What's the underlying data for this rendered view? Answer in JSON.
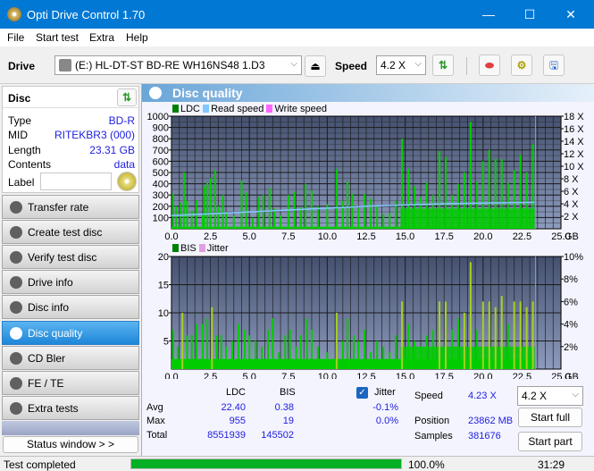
{
  "window": {
    "title": "Opti Drive Control 1.70",
    "minimize": "—",
    "maximize": "☐",
    "close": "✕"
  },
  "menu": [
    "File",
    "Start test",
    "Extra",
    "Help"
  ],
  "toolbar": {
    "drive_label": "Drive",
    "drive_value": "(E:)  HL-DT-ST BD-RE  WH16NS48 1.D3",
    "speed_label": "Speed",
    "speed_value": "4.2 X"
  },
  "disc": {
    "header": "Disc",
    "rows": [
      {
        "key": "Type",
        "value": "BD-R"
      },
      {
        "key": "MID",
        "value": "RITEKBR3 (000)"
      },
      {
        "key": "Length",
        "value": "23.31 GB"
      },
      {
        "key": "Contents",
        "value": "data"
      }
    ],
    "label_key": "Label",
    "label_value": ""
  },
  "nav": [
    {
      "label": "Transfer rate",
      "active": false
    },
    {
      "label": "Create test disc",
      "active": false
    },
    {
      "label": "Verify test disc",
      "active": false
    },
    {
      "label": "Drive info",
      "active": false
    },
    {
      "label": "Disc info",
      "active": false
    },
    {
      "label": "Disc quality",
      "active": true
    },
    {
      "label": "CD Bler",
      "active": false
    },
    {
      "label": "FE / TE",
      "active": false
    },
    {
      "label": "Extra tests",
      "active": false
    }
  ],
  "status_window_label": "Status window > >",
  "panel_title": "Disc quality",
  "chart_data": [
    {
      "type": "bar",
      "title": "LDC",
      "legend": [
        "LDC",
        "Read speed",
        "Write speed"
      ],
      "legend_colors": {
        "LDC": "#008000",
        "Read speed": "#80c8ff",
        "Write speed": "#ff66ff"
      },
      "xlabel": "GB",
      "xlim": [
        0,
        25
      ],
      "x_ticks": [
        "0.0",
        "2.5",
        "5.0",
        "7.5",
        "10.0",
        "12.5",
        "15.0",
        "17.5",
        "20.0",
        "22.5",
        "25.0"
      ],
      "ylim": [
        0,
        1000
      ],
      "y_ticks": [
        "100",
        "200",
        "300",
        "400",
        "500",
        "600",
        "700",
        "800",
        "900",
        "1000"
      ],
      "y2lim": [
        0,
        18
      ],
      "y2_ticks": [
        "2 X",
        "4 X",
        "6 X",
        "8 X",
        "10 X",
        "12 X",
        "14 X",
        "16 X",
        "18 X"
      ],
      "data_end_gb": 23.31,
      "ldc_peaks": [
        [
          0.1,
          310
        ],
        [
          0.3,
          200
        ],
        [
          0.6,
          230
        ],
        [
          0.8,
          500
        ],
        [
          1.0,
          250
        ],
        [
          1.3,
          160
        ],
        [
          1.6,
          250
        ],
        [
          2.0,
          120
        ],
        [
          2.1,
          380
        ],
        [
          2.3,
          410
        ],
        [
          2.5,
          450
        ],
        [
          2.8,
          520
        ],
        [
          3.0,
          200
        ],
        [
          3.3,
          300
        ],
        [
          3.5,
          150
        ],
        [
          4.0,
          120
        ],
        [
          4.5,
          430
        ],
        [
          4.8,
          320
        ],
        [
          5.2,
          100
        ],
        [
          5.6,
          280
        ],
        [
          5.9,
          300
        ],
        [
          6.3,
          360
        ],
        [
          6.6,
          180
        ],
        [
          7.0,
          120
        ],
        [
          7.5,
          300
        ],
        [
          7.9,
          330
        ],
        [
          8.3,
          190
        ],
        [
          8.6,
          400
        ],
        [
          9.0,
          340
        ],
        [
          9.4,
          200
        ],
        [
          10.0,
          220
        ],
        [
          10.6,
          530
        ],
        [
          11.0,
          250
        ],
        [
          11.3,
          420
        ],
        [
          11.6,
          310
        ],
        [
          12.0,
          180
        ],
        [
          12.4,
          310
        ],
        [
          12.8,
          270
        ],
        [
          13.2,
          200
        ],
        [
          13.6,
          130
        ],
        [
          14.0,
          140
        ],
        [
          14.4,
          250
        ],
        [
          14.8,
          800
        ],
        [
          15.2,
          530
        ],
        [
          15.6,
          380
        ],
        [
          16.0,
          280
        ],
        [
          16.4,
          410
        ],
        [
          16.8,
          300
        ],
        [
          17.2,
          690
        ],
        [
          17.6,
          640
        ],
        [
          18.0,
          300
        ],
        [
          18.4,
          400
        ],
        [
          18.8,
          500
        ],
        [
          19.2,
          950
        ],
        [
          19.6,
          420
        ],
        [
          20.0,
          600
        ],
        [
          20.4,
          700
        ],
        [
          20.8,
          620
        ],
        [
          21.2,
          620
        ],
        [
          21.6,
          410
        ],
        [
          22.0,
          520
        ],
        [
          22.4,
          660
        ],
        [
          22.8,
          500
        ],
        [
          23.2,
          750
        ]
      ],
      "read_speed_x": [
        [
          0,
          2.1
        ],
        [
          2.5,
          2.4
        ],
        [
          5,
          2.7
        ],
        [
          7.5,
          3.0
        ],
        [
          10,
          3.3
        ],
        [
          12.5,
          3.6
        ],
        [
          15,
          3.8
        ],
        [
          17.5,
          4.0
        ],
        [
          20,
          4.1
        ],
        [
          22.5,
          4.2
        ],
        [
          23.31,
          4.23
        ]
      ]
    },
    {
      "type": "bar",
      "title": "BIS",
      "legend": [
        "BIS",
        "Jitter"
      ],
      "legend_colors": {
        "BIS": "#008000",
        "Jitter": "#e0a0e0"
      },
      "xlabel": "GB",
      "xlim": [
        0,
        25
      ],
      "x_ticks": [
        "0.0",
        "2.5",
        "5.0",
        "7.5",
        "10.0",
        "12.5",
        "15.0",
        "17.5",
        "20.0",
        "22.5",
        "25.0"
      ],
      "ylim": [
        0,
        20
      ],
      "y_ticks": [
        "5",
        "10",
        "15",
        "20"
      ],
      "y2lim": [
        0,
        10
      ],
      "y2_ticks": [
        "2%",
        "4%",
        "6%",
        "8%",
        "10%"
      ],
      "data_end_gb": 23.31,
      "bis_peaks": [
        [
          0.1,
          7
        ],
        [
          0.4,
          4
        ],
        [
          0.7,
          10
        ],
        [
          1.0,
          6
        ],
        [
          1.3,
          6
        ],
        [
          1.6,
          8
        ],
        [
          2.0,
          8
        ],
        [
          2.3,
          9
        ],
        [
          2.6,
          11
        ],
        [
          2.9,
          6
        ],
        [
          3.2,
          6
        ],
        [
          3.5,
          4
        ],
        [
          3.9,
          5
        ],
        [
          4.3,
          8
        ],
        [
          4.7,
          7
        ],
        [
          5.0,
          6
        ],
        [
          5.4,
          5
        ],
        [
          5.8,
          4
        ],
        [
          6.2,
          7
        ],
        [
          6.5,
          9
        ],
        [
          6.9,
          3
        ],
        [
          7.3,
          6
        ],
        [
          7.6,
          7
        ],
        [
          8.0,
          4
        ],
        [
          8.3,
          6
        ],
        [
          8.7,
          9
        ],
        [
          9.0,
          7
        ],
        [
          9.4,
          4
        ],
        [
          10.0,
          3
        ],
        [
          10.6,
          10
        ],
        [
          11.0,
          5
        ],
        [
          11.3,
          9
        ],
        [
          11.7,
          6
        ],
        [
          12.0,
          5
        ],
        [
          12.4,
          7
        ],
        [
          12.8,
          3
        ],
        [
          13.2,
          5
        ],
        [
          13.6,
          4
        ],
        [
          14.0,
          3
        ],
        [
          14.4,
          6
        ],
        [
          14.8,
          12
        ],
        [
          15.2,
          8
        ],
        [
          15.6,
          5
        ],
        [
          16.0,
          4
        ],
        [
          16.4,
          6
        ],
        [
          16.8,
          7
        ],
        [
          17.2,
          12
        ],
        [
          17.6,
          12
        ],
        [
          18.0,
          7
        ],
        [
          18.4,
          9
        ],
        [
          18.8,
          10
        ],
        [
          19.2,
          19
        ],
        [
          19.6,
          7
        ],
        [
          20.0,
          12
        ],
        [
          20.4,
          12
        ],
        [
          20.8,
          11
        ],
        [
          21.2,
          13
        ],
        [
          21.6,
          8
        ],
        [
          22.0,
          12
        ],
        [
          22.4,
          12
        ],
        [
          22.8,
          11
        ],
        [
          23.2,
          12
        ]
      ]
    }
  ],
  "stats": {
    "col_ldc": "LDC",
    "col_bis": "BIS",
    "jitter_label": "Jitter",
    "jitter_checked": true,
    "rows": [
      {
        "label": "Avg",
        "ldc": "22.40",
        "bis": "0.38",
        "jitter": "-0.1%"
      },
      {
        "label": "Max",
        "ldc": "955",
        "bis": "19",
        "jitter": "0.0%"
      },
      {
        "label": "Total",
        "ldc": "8551939",
        "bis": "145502",
        "jitter": ""
      }
    ],
    "speed_label": "Speed",
    "speed_value": "4.23 X",
    "position_label": "Position",
    "position_value": "23862 MB",
    "samples_label": "Samples",
    "samples_value": "381676",
    "speed_select": "4.2 X",
    "start_full": "Start full",
    "start_part": "Start part"
  },
  "statusbar": {
    "text": "Test completed",
    "progress": 100.0,
    "progress_text": "100.0%",
    "time": "31:29"
  }
}
